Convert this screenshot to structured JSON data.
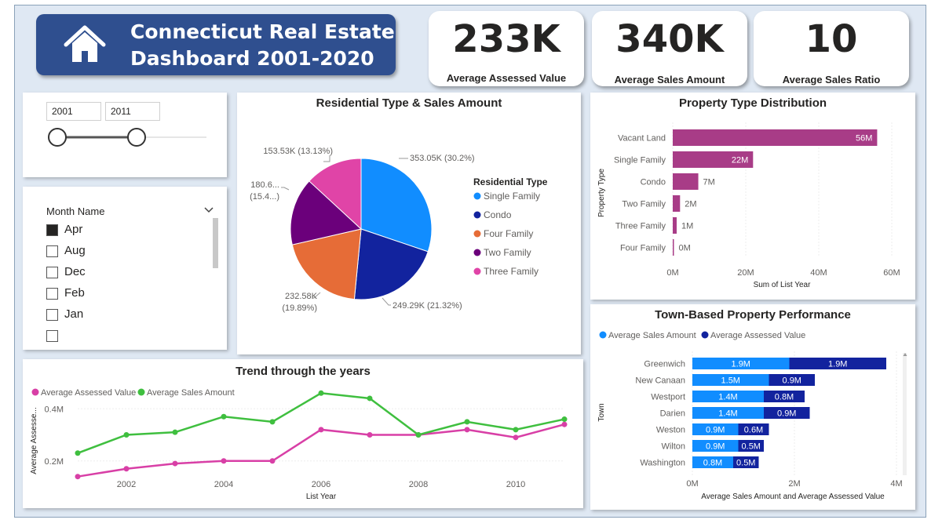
{
  "header": {
    "title_line1": "Connecticut Real Estate",
    "title_line2": "Dashboard 2001-2020"
  },
  "kpis": [
    {
      "value": "233K",
      "label": "Average Assessed Value"
    },
    {
      "value": "340K",
      "label": "Average Sales Amount"
    },
    {
      "value": "10",
      "label": "Average Sales Ratio"
    }
  ],
  "year_slicer": {
    "from": "2001",
    "to": "2011"
  },
  "month_slicer": {
    "title": "Month Name",
    "items": [
      {
        "label": "Apr",
        "checked": true
      },
      {
        "label": "Aug",
        "checked": false
      },
      {
        "label": "Dec",
        "checked": false
      },
      {
        "label": "Feb",
        "checked": false
      },
      {
        "label": "Jan",
        "checked": false
      }
    ]
  },
  "colors": {
    "banner": "#2f4f8f",
    "single_family": "#118dff",
    "condo": "#12239e",
    "four_family": "#e66c37",
    "two_family": "#6b007b",
    "three_family": "#e044a7",
    "property_bar": "#a83c87",
    "sales_line": "#3fbf3f",
    "assessed_line": "#d83fa6",
    "sales_bar": "#118dff",
    "assessed_bar": "#12239e"
  },
  "chart_data": [
    {
      "type": "pie",
      "title": "Residential Type & Sales Amount",
      "legend_title": "Residential Type",
      "slices": [
        {
          "name": "Single Family",
          "value": 353.05,
          "label": "353.05K (30.2%)"
        },
        {
          "name": "Condo",
          "value": 249.29,
          "label": "249.29K (21.32%)"
        },
        {
          "name": "Four Family",
          "value": 232.58,
          "label": "232.58K",
          "label2": "(19.89%)"
        },
        {
          "name": "Two Family",
          "value": 180.6,
          "label": "180.6...",
          "label2": "(15.4...)"
        },
        {
          "name": "Three Family",
          "value": 153.53,
          "label": "153.53K (13.13%)"
        }
      ]
    },
    {
      "type": "bar",
      "orientation": "horizontal",
      "title": "Property Type Distribution",
      "xlabel": "Sum of List Year",
      "ylabel": "Property Type",
      "xlim": [
        0,
        60
      ],
      "xticks": [
        "0M",
        "20M",
        "40M",
        "60M"
      ],
      "categories": [
        "Vacant Land",
        "Single Family",
        "Condo",
        "Two Family",
        "Three Family",
        "Four Family"
      ],
      "values": [
        56,
        22,
        7,
        2,
        1,
        0
      ],
      "data_labels": [
        "56M",
        "22M",
        "7M",
        "2M",
        "1M",
        "0M"
      ]
    },
    {
      "type": "line",
      "title": "Trend through the years",
      "xlabel": "List Year",
      "ylabel": "Average Assesse...",
      "xlim": [
        2001,
        2011
      ],
      "ylim": [
        0.1,
        0.5
      ],
      "xticks": [
        "2002",
        "2004",
        "2006",
        "2008",
        "2010"
      ],
      "yticks": [
        "0.2M",
        "0.4M"
      ],
      "x": [
        2001,
        2002,
        2003,
        2004,
        2005,
        2006,
        2007,
        2008,
        2009,
        2010,
        2011
      ],
      "series": [
        {
          "name": "Average Assessed Value",
          "values": [
            0.14,
            0.17,
            0.19,
            0.2,
            0.2,
            0.32,
            0.3,
            0.3,
            0.32,
            0.29,
            0.34
          ]
        },
        {
          "name": "Average Sales Amount",
          "values": [
            0.23,
            0.3,
            0.31,
            0.37,
            0.35,
            0.46,
            0.44,
            0.3,
            0.35,
            0.32,
            0.36
          ]
        }
      ]
    },
    {
      "type": "bar",
      "orientation": "horizontal",
      "stacked": true,
      "title": "Town-Based Property Performance",
      "xlabel": "Average Sales Amount and Average Assessed Value",
      "ylabel": "Town",
      "xlim": [
        0,
        4
      ],
      "xticks": [
        "0M",
        "2M",
        "4M"
      ],
      "categories": [
        "Greenwich",
        "New Canaan",
        "Westport",
        "Darien",
        "Weston",
        "Wilton",
        "Washington"
      ],
      "series": [
        {
          "name": "Average Sales Amount",
          "values": [
            1.9,
            1.5,
            1.4,
            1.4,
            0.9,
            0.9,
            0.8
          ],
          "labels": [
            "1.9M",
            "1.5M",
            "1.4M",
            "1.4M",
            "0.9M",
            "0.9M",
            "0.8M"
          ]
        },
        {
          "name": "Average Assessed Value",
          "values": [
            1.9,
            0.9,
            0.8,
            0.9,
            0.6,
            0.5,
            0.5
          ],
          "labels": [
            "1.9M",
            "0.9M",
            "0.8M",
            "0.9M",
            "0.6M",
            "0.5M",
            "0.5M"
          ]
        }
      ]
    }
  ]
}
